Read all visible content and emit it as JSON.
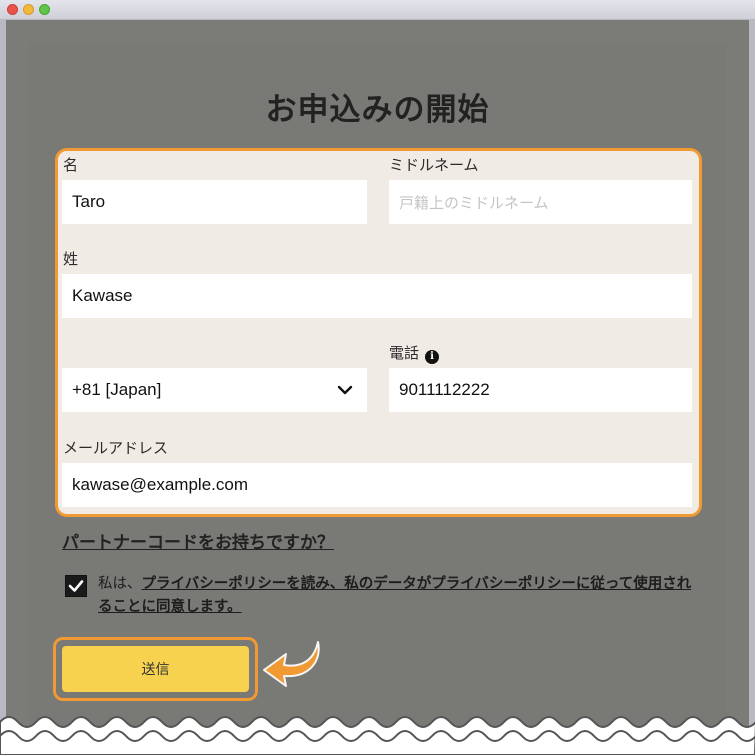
{
  "window": {
    "controls": [
      "close",
      "minimize",
      "maximize"
    ]
  },
  "page": {
    "title": "お申込みの開始"
  },
  "form": {
    "first_name": {
      "label": "名",
      "value": "Taro"
    },
    "middle_name": {
      "label": "ミドルネーム",
      "placeholder": "戸籍上のミドルネーム",
      "value": ""
    },
    "last_name": {
      "label": "姓",
      "value": "Kawase"
    },
    "country_code": {
      "value": "+81 [Japan]"
    },
    "phone": {
      "label": "電話",
      "value": "9011112222"
    },
    "email": {
      "label": "メールアドレス",
      "value": "kawase@example.com"
    }
  },
  "partner_link": "パートナーコードをお持ちですか？",
  "consent": {
    "checked": true,
    "prefix": "私は、",
    "link_text": "プライバシーポリシーを読み、私のデータがプライバシーポリシーに従って使用されることに同意します。"
  },
  "submit_label": "送信",
  "colors": {
    "highlight": "#f19a33",
    "button": "#f7d24e",
    "background": "#7b7b77",
    "form_bg": "#f0ebe5"
  },
  "icons": [
    "info-icon",
    "chevron-down-icon",
    "checkmark-icon",
    "pointer-arrow-icon"
  ]
}
